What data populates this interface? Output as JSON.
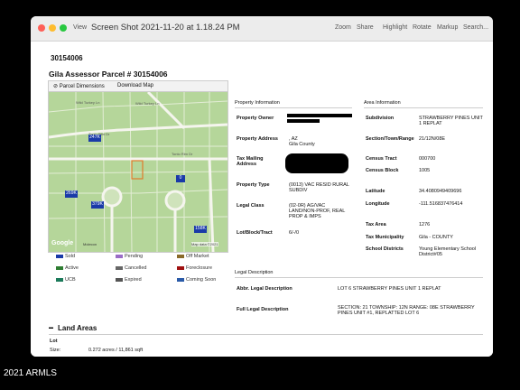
{
  "window": {
    "view_label": "View",
    "title": "Screen Shot 2021-11-20 at 1.18.24 PM",
    "toolbar": [
      "Zoom",
      "Share",
      "Highlight",
      "Rotate",
      "Markup",
      "Search..."
    ]
  },
  "parcel_number": "30154006",
  "page_heading": "Gila Assessor Parcel # 30154006",
  "map": {
    "tab_dimensions": "Parcel Dimensions",
    "tab_download": "Download Map",
    "street_labels": [
      "Wild Turkey Ln",
      "Wild Turkey Ln",
      "Tonto Rim Dr",
      "Tonto Rim Dr",
      "Bear Track"
    ],
    "markers": [
      {
        "label": "247K",
        "color": "#1a3aa8"
      },
      {
        "label": "269K",
        "color": "#1a3aa8"
      },
      {
        "label": "379K",
        "color": "#1a3aa8"
      },
      {
        "label": "0",
        "color": "#1a3aa8"
      },
      {
        "label": "158K",
        "color": "#1a3aa8"
      }
    ],
    "google": "Google",
    "molecon": "Molecon",
    "mapdata": "Map data ©2021"
  },
  "legend": [
    {
      "label": "Sold",
      "color": "#1a3aa8"
    },
    {
      "label": "Pending",
      "color": "#9a6cc7"
    },
    {
      "label": "Off Market",
      "color": "#8a6a2a"
    },
    {
      "label": "Active",
      "color": "#2e7d32"
    },
    {
      "label": "Cancelled",
      "color": "#666666"
    },
    {
      "label": "Foreclosure",
      "color": "#a01010"
    },
    {
      "label": "UCB",
      "color": "#1b7a5a"
    },
    {
      "label": "Expired",
      "color": "#555555"
    },
    {
      "label": "Coming Soon",
      "color": "#2a5aa8"
    }
  ],
  "property": {
    "section_title": "Property Information",
    "rows": [
      {
        "label": "Property Owner",
        "value": ""
      },
      {
        "label": "Property Address",
        "value": ", AZ\nGila County"
      },
      {
        "label": "Tax Mailing Address",
        "value": ""
      },
      {
        "label": "Property Type",
        "value": "(0013) VAC RESID RURAL SUBDIV"
      },
      {
        "label": "Legal Class",
        "value": "(02-0R) AG/VAC LAND/NON-PROF, REAL PROP & IMPS"
      },
      {
        "label": "Lot/Block/Tract",
        "value": "6/-/0"
      }
    ]
  },
  "area": {
    "section_title": "Area Information",
    "rows": [
      {
        "label": "Subdivision",
        "value": "STRAWBERRY PINES UNIT 1 REPLAT"
      },
      {
        "label": "Section/Town/Range",
        "value": "21/12N/08E"
      },
      {
        "label": "Census Tract",
        "value": "000700"
      },
      {
        "label": "Census Block",
        "value": "1005"
      },
      {
        "label": "Latitude",
        "value": "34.4080949409696"
      },
      {
        "label": "Longitude",
        "value": "-111.516837476414"
      },
      {
        "label": "Tax Area",
        "value": "1276"
      },
      {
        "label": "Tax Municipality",
        "value": "Gila - COUNTY"
      },
      {
        "label": "School Districts",
        "value": "Young Elementary School District#05"
      }
    ]
  },
  "legal": {
    "section_title": "Legal Description",
    "rows": [
      {
        "label": "Abbr. Legal Description",
        "value": "LOT 6 STRAWBERRY PINES UNIT 1 REPLAT"
      },
      {
        "label": "Full Legal Description",
        "value": "SECTION: 21 TOWNSHIP: 12N RANGE: 08E STRAWBERRY PINES UNIT #1, REPLATTED LOT 6"
      }
    ]
  },
  "land": {
    "section_title": "Land Areas",
    "sub": "Lot",
    "size_label": "Size:",
    "size_value": "0.272 acres / 11,861 sqft"
  },
  "copyright": "2021 ARMLS"
}
